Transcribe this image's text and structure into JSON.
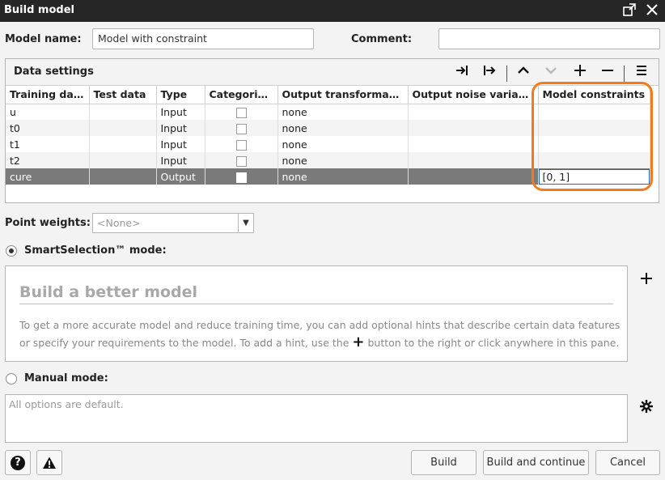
{
  "window": {
    "title": "Build model",
    "restore_icon": "restore-window-icon",
    "close_icon": "close-icon"
  },
  "form": {
    "model_name_label": "Model name:",
    "model_name_value": "Model with constraint",
    "comment_label": "Comment:",
    "comment_value": ""
  },
  "data_settings": {
    "title": "Data settings",
    "toolbar": [
      "move-to-test-icon",
      "move-to-training-icon",
      "move-up-icon",
      "move-down-icon",
      "add-icon",
      "remove-icon",
      "menu-icon"
    ],
    "columns": [
      "Training data",
      "Test data",
      "Type",
      "Categorical",
      "Output transformati...",
      "Output noise variance",
      "Model constraints"
    ],
    "rows": [
      {
        "training": "u",
        "test": "",
        "type": "Input",
        "categorical": false,
        "transform": "none",
        "noise": "",
        "constraints": ""
      },
      {
        "training": "t0",
        "test": "",
        "type": "Input",
        "categorical": false,
        "transform": "none",
        "noise": "",
        "constraints": ""
      },
      {
        "training": "t1",
        "test": "",
        "type": "Input",
        "categorical": false,
        "transform": "none",
        "noise": "",
        "constraints": ""
      },
      {
        "training": "t2",
        "test": "",
        "type": "Input",
        "categorical": false,
        "transform": "none",
        "noise": "",
        "constraints": ""
      },
      {
        "training": "cure",
        "test": "",
        "type": "Output",
        "categorical": false,
        "transform": "none",
        "noise": "",
        "constraints": "[0, 1]"
      }
    ],
    "selected_row": 4,
    "highlight_color": "#f07c1f"
  },
  "point_weights": {
    "label": "Point weights:",
    "value": "<None>"
  },
  "smart_selection": {
    "label": "SmartSelection™ mode:",
    "selected": true,
    "heading": "Build a better model",
    "text_before": "To get a more accurate model and reduce training time, you can add optional hints that describe certain data features or specify your requirements to the model. To add a hint, use the",
    "text_after": "button to the right or click anywhere in this pane.",
    "add_icon": "plus-icon"
  },
  "manual_mode": {
    "label": "Manual mode:",
    "selected": false,
    "text": "All options are default.",
    "settings_icon": "gear-icon"
  },
  "footer": {
    "help_icon": "help-icon",
    "warning_icon": "warning-icon",
    "build_label": "Build",
    "build_continue_label": "Build and continue",
    "cancel_label": "Cancel"
  }
}
